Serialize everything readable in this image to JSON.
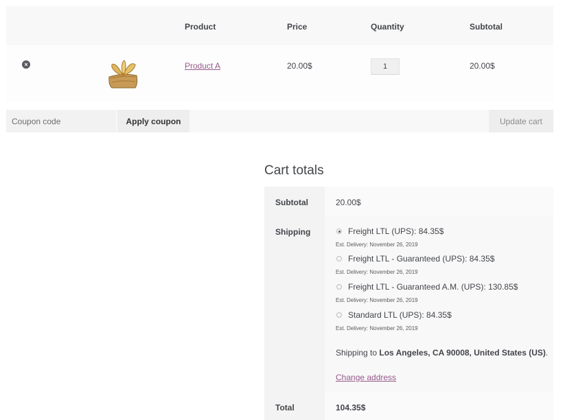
{
  "cart": {
    "headers": {
      "product": "Product",
      "price": "Price",
      "quantity": "Quantity",
      "subtotal": "Subtotal"
    },
    "item": {
      "remove_glyph": "×",
      "name": "Product A",
      "price": "20.00$",
      "quantity": "1",
      "subtotal": "20.00$",
      "thumbnail_icon": "gift-package-image"
    }
  },
  "actions": {
    "coupon_placeholder": "Coupon code",
    "apply_coupon_label": "Apply coupon",
    "update_cart_label": "Update cart"
  },
  "totals": {
    "title": "Cart totals",
    "subtotal_label": "Subtotal",
    "subtotal_value": "20.00$",
    "shipping_label": "Shipping",
    "shipping_options": [
      {
        "label": "Freight LTL (UPS): 84.35$",
        "est": "Est. Delivery: November 26, 2019",
        "selected": true
      },
      {
        "label": "Freight LTL - Guaranteed (UPS): 84.35$",
        "est": "Est. Delivery: November 26, 2019",
        "selected": false
      },
      {
        "label": "Freight LTL - Guaranteed A.M. (UPS): 130.85$",
        "est": "Est. Delivery: November 26, 2019",
        "selected": false
      },
      {
        "label": "Standard LTL (UPS): 84.35$",
        "est": "Est. Delivery: November 26, 2019",
        "selected": false
      }
    ],
    "shipping_to_prefix": "Shipping to ",
    "shipping_to_location": "Los Angeles, CA 90008, United States (US)",
    "shipping_to_suffix": ".",
    "change_address_label": "Change address",
    "total_label": "Total",
    "total_value": "104.35$"
  },
  "colors": {
    "link": "#96588a",
    "text": "#43454b"
  }
}
